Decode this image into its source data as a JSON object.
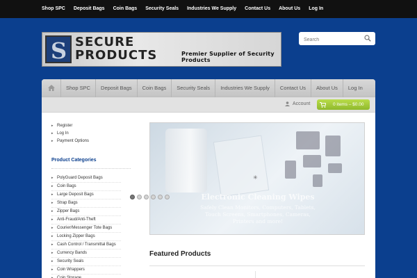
{
  "topnav": [
    "Shop SPC",
    "Deposit Bags",
    "Coin Bags",
    "Security Seals",
    "Industries We Supply",
    "Contact Us",
    "About Us",
    "Log In"
  ],
  "logo": {
    "line1": "SECURE",
    "line2": "PRODUCTS",
    "tagline": "Premier Supplier of Security Products"
  },
  "search": {
    "placeholder": "Search"
  },
  "mainnav": [
    "Shop SPC",
    "Deposit Bags",
    "Coin Bags",
    "Security Seals",
    "Industries We Supply",
    "Contact Us",
    "About Us",
    "Log In"
  ],
  "account_label": "Account",
  "cart_label": "0 items – $0.00",
  "sidebar": {
    "account_links": [
      "Register",
      "Log In",
      "Payment Options"
    ],
    "categories_heading": "Product Categories",
    "categories": [
      "PolyGuard Deposit Bags",
      "Coin Bags",
      "Large Deposit Bags",
      "Strap Bags",
      "Zipper Bags",
      "Anti-Fraud/Anti-Theft",
      "Courier/Messenger Tote Bags",
      "Locking Zipper Bags",
      "Cash Control / Transmittal Bags",
      "Currency Bands",
      "Security Seals",
      "Coin Wrappers",
      "Coin Storage"
    ]
  },
  "slider": {
    "title": "Electronic Cleaning Wipes",
    "description": "Safely Clean Monitors, Computers, Tablets, Touch Screens, Smartphones, Cameras, Printers and more!",
    "dot_count": 6,
    "active_dot": 1
  },
  "featured_heading": "Featured Products",
  "colors": {
    "background": "#0b3f8e",
    "topbar": "#111111",
    "cart": "#9ccb34",
    "heading_blue": "#0b3f8e"
  }
}
